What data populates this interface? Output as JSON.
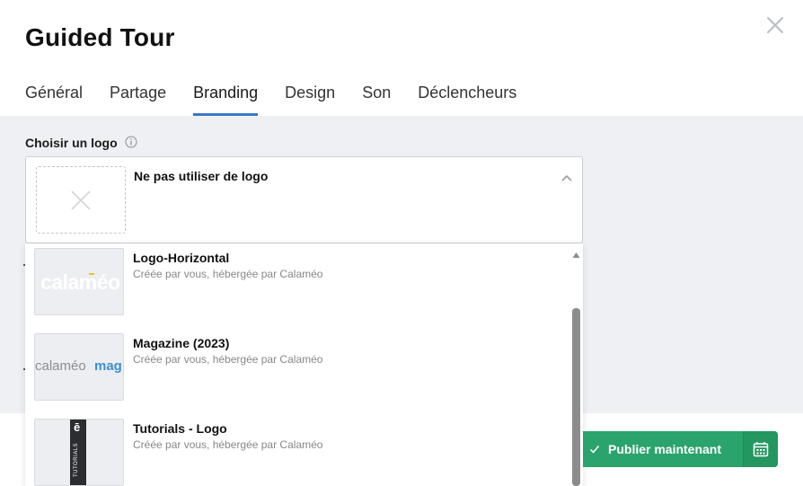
{
  "dialog": {
    "title": "Guided Tour"
  },
  "tabs": [
    {
      "label": "Général"
    },
    {
      "label": "Partage"
    },
    {
      "label": "Branding"
    },
    {
      "label": "Design"
    },
    {
      "label": "Son"
    },
    {
      "label": "Déclencheurs"
    }
  ],
  "active_tab": "Branding",
  "logo_picker": {
    "label": "Choisir un logo",
    "selected_label": "Ne pas utiliser de logo",
    "options": [
      {
        "name": "Logo-Horizontal",
        "subtitle": "Créée par vous, hébergée par Calaméo",
        "thumb_text": "calaméo"
      },
      {
        "name": "Magazine (2023)",
        "subtitle": "Créée par vous, hébergée par Calaméo",
        "thumb_text": "calaméo",
        "thumb_text_2": "mag"
      },
      {
        "name": "Tutorials - Logo",
        "subtitle": "Créée par vous, hébergée par Calaméo",
        "thumb_text": "TUTORIALS",
        "thumb_glyph": "ē"
      }
    ]
  },
  "footer": {
    "publish_label": "Publier maintenant"
  },
  "colors": {
    "accent": "#3a78c9",
    "publish_green": "#2aa46c",
    "body_bg": "#eef0f3",
    "thumb_blue": "#3d8fd1"
  }
}
